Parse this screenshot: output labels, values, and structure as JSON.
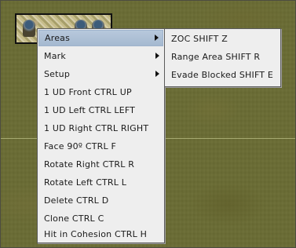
{
  "main_menu": {
    "items": [
      {
        "label": "Areas",
        "has_submenu": true,
        "active": true
      },
      {
        "label": "Mark",
        "has_submenu": true
      },
      {
        "label": "Setup",
        "has_submenu": true
      },
      {
        "label": "1 UD Front  CTRL UP"
      },
      {
        "label": "1 UD Left  CTRL LEFT"
      },
      {
        "label": "1 UD Right  CTRL RIGHT"
      },
      {
        "label": "Face 90º  CTRL F"
      },
      {
        "label": "Rotate Right  CTRL R"
      },
      {
        "label": "Rotate Left  CTRL L"
      },
      {
        "label": "Delete  CTRL D"
      },
      {
        "label": "Clone  CTRL C"
      },
      {
        "label": "Hit in Cohesion  CTRL H"
      }
    ]
  },
  "submenu": {
    "items": [
      {
        "label": "ZOC  SHIFT Z"
      },
      {
        "label": "Range Area  SHIFT R"
      },
      {
        "label": "Evade Blocked  SHIFT E"
      }
    ]
  },
  "colors": {
    "menu_background": "#eeeeee",
    "highlight": "#b7c8dc",
    "map_background": "#6a6c33"
  }
}
